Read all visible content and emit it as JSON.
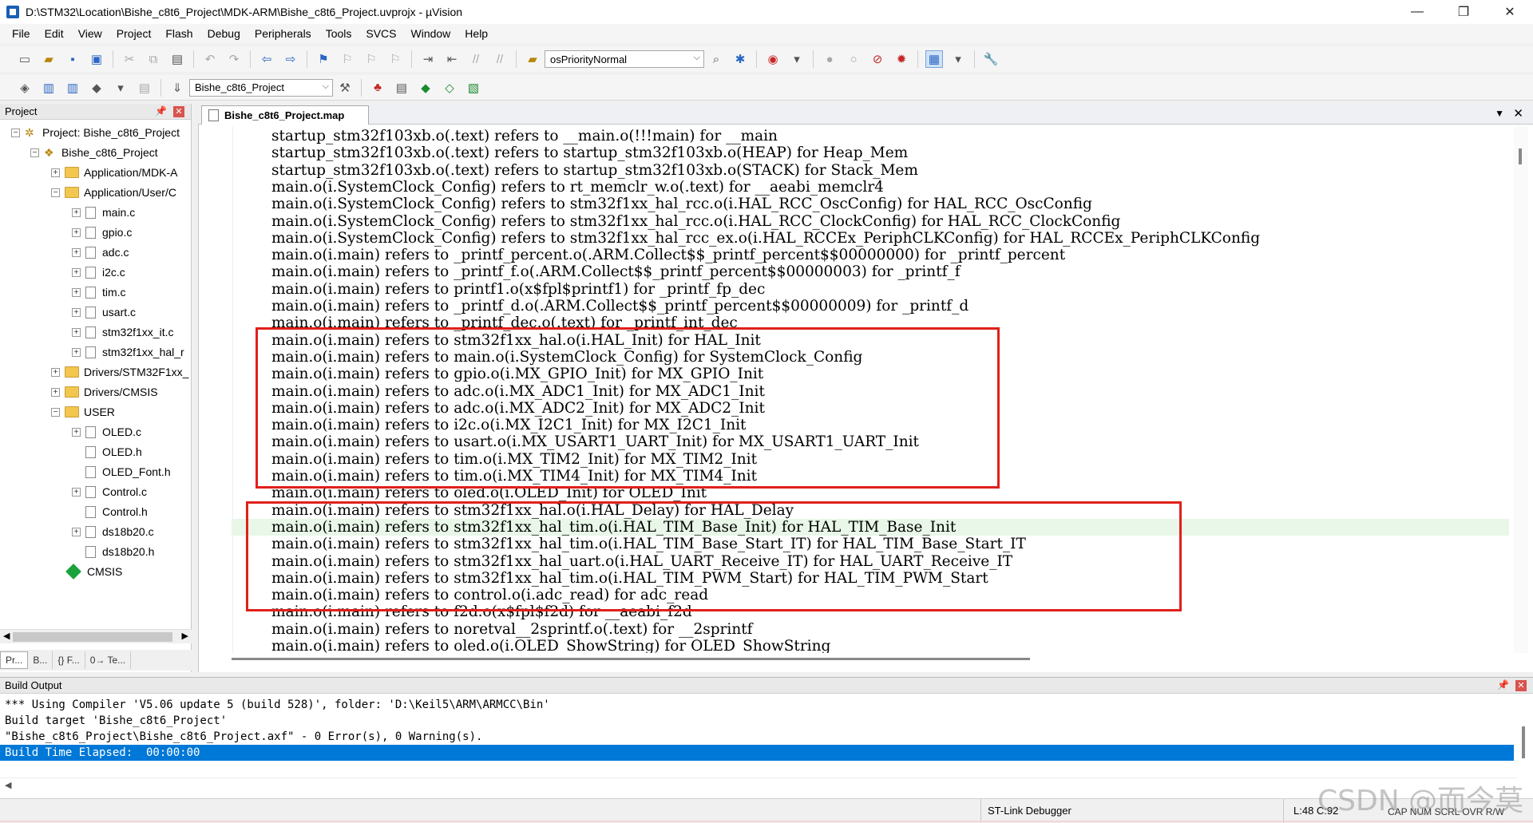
{
  "window": {
    "title": "D:\\STM32\\Location\\Bishe_c8t6_Project\\MDK-ARM\\Bishe_c8t6_Project.uvprojx - µVision",
    "minimize": "—",
    "maximize": "❐",
    "close": "✕"
  },
  "menu": [
    "File",
    "Edit",
    "View",
    "Project",
    "Flash",
    "Debug",
    "Peripherals",
    "Tools",
    "SVCS",
    "Window",
    "Help"
  ],
  "toolbar": {
    "priority_combo": "osPriorityNormal",
    "target_combo": "Bishe_c8t6_Project"
  },
  "project_panel": {
    "title": "Project",
    "tree": [
      {
        "label": "Project: Bishe_c8t6_Project",
        "level": 0,
        "kind": "project",
        "expander": "−"
      },
      {
        "label": "Bishe_c8t6_Project",
        "level": 1,
        "kind": "target",
        "expander": "−"
      },
      {
        "label": "Application/MDK-A",
        "level": 2,
        "kind": "folder",
        "expander": "+"
      },
      {
        "label": "Application/User/C",
        "level": 2,
        "kind": "folder",
        "expander": "−"
      },
      {
        "label": "main.c",
        "level": 3,
        "kind": "file",
        "expander": "+"
      },
      {
        "label": "gpio.c",
        "level": 3,
        "kind": "file",
        "expander": "+"
      },
      {
        "label": "adc.c",
        "level": 3,
        "kind": "file",
        "expander": "+"
      },
      {
        "label": "i2c.c",
        "level": 3,
        "kind": "file",
        "expander": "+"
      },
      {
        "label": "tim.c",
        "level": 3,
        "kind": "file",
        "expander": "+"
      },
      {
        "label": "usart.c",
        "level": 3,
        "kind": "file",
        "expander": "+"
      },
      {
        "label": "stm32f1xx_it.c",
        "level": 3,
        "kind": "file",
        "expander": "+"
      },
      {
        "label": "stm32f1xx_hal_r",
        "level": 3,
        "kind": "file",
        "expander": "+"
      },
      {
        "label": "Drivers/STM32F1xx_",
        "level": 2,
        "kind": "folder",
        "expander": "+"
      },
      {
        "label": "Drivers/CMSIS",
        "level": 2,
        "kind": "folder",
        "expander": "+"
      },
      {
        "label": "USER",
        "level": 2,
        "kind": "folder",
        "expander": "−"
      },
      {
        "label": "OLED.c",
        "level": 3,
        "kind": "file",
        "expander": "+"
      },
      {
        "label": "OLED.h",
        "level": 3,
        "kind": "file",
        "expander": ""
      },
      {
        "label": "OLED_Font.h",
        "level": 3,
        "kind": "file",
        "expander": ""
      },
      {
        "label": "Control.c",
        "level": 3,
        "kind": "file",
        "expander": "+"
      },
      {
        "label": "Control.h",
        "level": 3,
        "kind": "file",
        "expander": ""
      },
      {
        "label": "ds18b20.c",
        "level": 3,
        "kind": "file",
        "expander": "+"
      },
      {
        "label": "ds18b20.h",
        "level": 3,
        "kind": "file",
        "expander": ""
      },
      {
        "label": "CMSIS",
        "level": 2,
        "kind": "cmsis",
        "expander": ""
      }
    ],
    "tabs": [
      "Pr...",
      "B...",
      "{} F...",
      "0→ Te..."
    ]
  },
  "editor": {
    "tab_title": "Bishe_c8t6_Project.map",
    "lines": [
      "startup_stm32f103xb.o(.text) refers to __main.o(!!!main) for __main",
      "startup_stm32f103xb.o(.text) refers to startup_stm32f103xb.o(HEAP) for Heap_Mem",
      "startup_stm32f103xb.o(.text) refers to startup_stm32f103xb.o(STACK) for Stack_Mem",
      "main.o(i.SystemClock_Config) refers to rt_memclr_w.o(.text) for __aeabi_memclr4",
      "main.o(i.SystemClock_Config) refers to stm32f1xx_hal_rcc.o(i.HAL_RCC_OscConfig) for HAL_RCC_OscConfig",
      "main.o(i.SystemClock_Config) refers to stm32f1xx_hal_rcc.o(i.HAL_RCC_ClockConfig) for HAL_RCC_ClockConfig",
      "main.o(i.SystemClock_Config) refers to stm32f1xx_hal_rcc_ex.o(i.HAL_RCCEx_PeriphCLKConfig) for HAL_RCCEx_PeriphCLKConfig",
      "main.o(i.main) refers to _printf_percent.o(.ARM.Collect$$_printf_percent$$00000000) for _printf_percent",
      "main.o(i.main) refers to _printf_f.o(.ARM.Collect$$_printf_percent$$00000003) for _printf_f",
      "main.o(i.main) refers to printf1.o(x$fpl$printf1) for _printf_fp_dec",
      "main.o(i.main) refers to _printf_d.o(.ARM.Collect$$_printf_percent$$00000009) for _printf_d",
      "main.o(i.main) refers to _printf_dec.o(.text) for _printf_int_dec",
      "main.o(i.main) refers to stm32f1xx_hal.o(i.HAL_Init) for HAL_Init",
      "main.o(i.main) refers to main.o(i.SystemClock_Config) for SystemClock_Config",
      "main.o(i.main) refers to gpio.o(i.MX_GPIO_Init) for MX_GPIO_Init",
      "main.o(i.main) refers to adc.o(i.MX_ADC1_Init) for MX_ADC1_Init",
      "main.o(i.main) refers to adc.o(i.MX_ADC2_Init) for MX_ADC2_Init",
      "main.o(i.main) refers to i2c.o(i.MX_I2C1_Init) for MX_I2C1_Init",
      "main.o(i.main) refers to usart.o(i.MX_USART1_UART_Init) for MX_USART1_UART_Init",
      "main.o(i.main) refers to tim.o(i.MX_TIM2_Init) for MX_TIM2_Init",
      "main.o(i.main) refers to tim.o(i.MX_TIM4_Init) for MX_TIM4_Init",
      "main.o(i.main) refers to oled.o(i.OLED_Init) for OLED_Init",
      "main.o(i.main) refers to stm32f1xx_hal.o(i.HAL_Delay) for HAL_Delay",
      "main.o(i.main) refers to stm32f1xx_hal_tim.o(i.HAL_TIM_Base_Init) for HAL_TIM_Base_Init",
      "main.o(i.main) refers to stm32f1xx_hal_tim.o(i.HAL_TIM_Base_Start_IT) for HAL_TIM_Base_Start_IT",
      "main.o(i.main) refers to stm32f1xx_hal_uart.o(i.HAL_UART_Receive_IT) for HAL_UART_Receive_IT",
      "main.o(i.main) refers to stm32f1xx_hal_tim.o(i.HAL_TIM_PWM_Start) for HAL_TIM_PWM_Start",
      "main.o(i.main) refers to control.o(i.adc_read) for adc_read",
      "main.o(i.main) refers to f2d.o(x$fpl$f2d) for __aeabi_f2d",
      "main.o(i.main) refers to noretval__2sprintf.o(.text) for __2sprintf",
      "main.o(i.main) refers to oled.o(i.OLED_ShowString) for OLED_ShowString"
    ],
    "current_line_index": 23,
    "highlight_color": "#e0201b"
  },
  "build_output": {
    "title": "Build Output",
    "lines": [
      "*** Using Compiler 'V5.06 update 5 (build 528)', folder: 'D:\\Keil5\\ARM\\ARMCC\\Bin'",
      "Build target 'Bishe_c8t6_Project'",
      "\"Bishe_c8t6_Project\\Bishe_c8t6_Project.axf\" - 0 Error(s), 0 Warning(s).",
      "Build Time Elapsed:  00:00:00"
    ]
  },
  "status": {
    "debugger": "ST-Link Debugger",
    "position": "L:48 C:92",
    "keys": "CAP  NUM  SCRL  OVR  R/W"
  },
  "watermark": "CSDN @而今莫"
}
